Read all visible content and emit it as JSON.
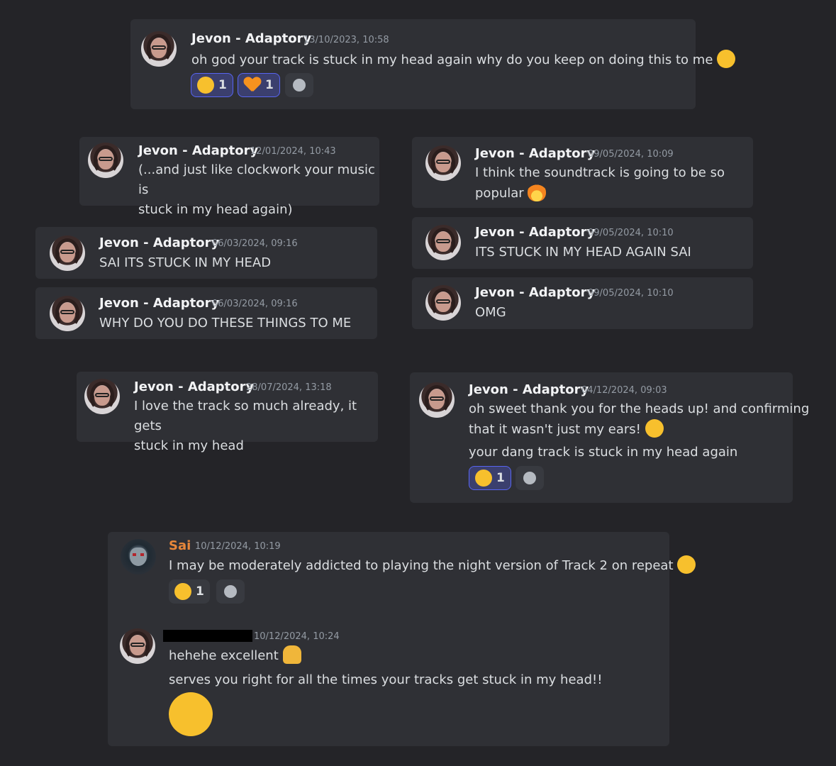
{
  "messages": {
    "m1": {
      "name": "Jevon - Adaptory",
      "timestamp": "13/10/2023, 10:58",
      "text": "oh god your track is stuck in my head again why do you keep on doing this to me",
      "reactions": [
        {
          "emoji": "grinning-squint-face",
          "count": "1"
        },
        {
          "emoji": "orange-heart",
          "count": "1"
        }
      ]
    },
    "m2": {
      "name": "Jevon - Adaptory",
      "timestamp": "12/01/2024, 10:43",
      "line1": "(...and just like clockwork your music is",
      "line2": "stuck in my head again)"
    },
    "m3": {
      "name": "Jevon - Adaptory",
      "timestamp": "09/05/2024, 10:09",
      "line1": "I think the soundtrack is going to be so",
      "line2": "popular"
    },
    "m4": {
      "name": "Jevon - Adaptory",
      "timestamp": "06/03/2024, 09:16",
      "text": "SAI ITS STUCK IN MY HEAD"
    },
    "m5": {
      "name": "Jevon - Adaptory",
      "timestamp": "09/05/2024, 10:10",
      "text": "ITS STUCK IN MY HEAD AGAIN SAI"
    },
    "m6": {
      "name": "Jevon - Adaptory",
      "timestamp": "06/03/2024, 09:16",
      "text": "WHY DO YOU DO THESE THINGS TO ME"
    },
    "m7": {
      "name": "Jevon - Adaptory",
      "timestamp": "09/05/2024, 10:10",
      "text": "OMG"
    },
    "m8": {
      "name": "Jevon - Adaptory",
      "timestamp": "28/07/2024, 13:18",
      "line1": "I love the track so much already, it gets",
      "line2": "stuck in my head"
    },
    "m9": {
      "name": "Jevon - Adaptory",
      "timestamp": "04/12/2024, 09:03",
      "line1": "oh sweet thank you for the heads up! and confirming",
      "line2": "that it wasn't just my ears!",
      "line3": "your dang track is stuck in my head again",
      "reactions": [
        {
          "emoji": "grinning-squint-face",
          "count": "1"
        }
      ]
    },
    "m10": {
      "name": "Sai",
      "timestamp": "10/12/2024, 10:19",
      "text": "I may be moderately addicted to playing the night version of Track 2 on repeat",
      "reactions": [
        {
          "emoji": "face-with-tears-of-joy",
          "count": "1"
        }
      ]
    },
    "m11": {
      "timestamp": "10/12/2024, 10:24",
      "line1": "hehehe excellent",
      "line2": "serves you right for all the times your tracks get stuck in my head!!"
    }
  },
  "colors": {
    "background": "#242428",
    "card": "#2f3035",
    "accent": "#5865f2",
    "sai_name": "#e8873a"
  }
}
